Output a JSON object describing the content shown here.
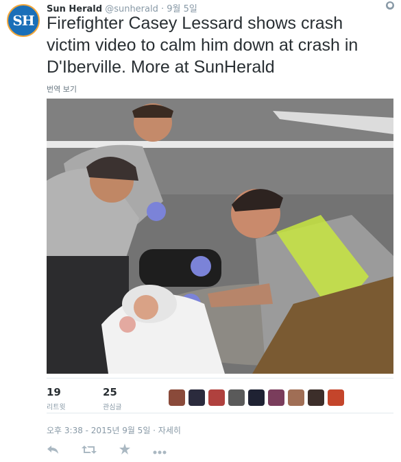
{
  "account": {
    "name": "Sun Herald",
    "handle": "@sunherald",
    "separator": "·",
    "date": "9월 5일",
    "avatar_text": "SH"
  },
  "tweet": {
    "text": "Firefighter Casey Lessard shows crash victim video to calm him down at crash in D'Iberville. More at SunHerald",
    "translate_label": "번역 보기"
  },
  "stats": {
    "retweets": {
      "count": "19",
      "label": "리트윗"
    },
    "likes": {
      "count": "25",
      "label": "관심글"
    }
  },
  "likers": [
    {
      "icon": "liker-avatar-1",
      "color": "#8a4a3a"
    },
    {
      "icon": "liker-avatar-2",
      "color": "#2b2b3d"
    },
    {
      "icon": "liker-avatar-3",
      "color": "#b0413e"
    },
    {
      "icon": "liker-avatar-4",
      "color": "#5a5a5a"
    },
    {
      "icon": "liker-avatar-5",
      "color": "#1f2233"
    },
    {
      "icon": "liker-avatar-6",
      "color": "#7a3d5c"
    },
    {
      "icon": "liker-avatar-7",
      "color": "#a06e55"
    },
    {
      "icon": "liker-avatar-8",
      "color": "#3c2e2a"
    },
    {
      "icon": "liker-avatar-9",
      "color": "#c4452b"
    }
  ],
  "timestamp": "오후 3:38 - 2015년 9월 5일 · 자세히",
  "actions": {
    "reply": "reply-icon",
    "retweet": "retweet-icon",
    "favorite": "star-icon",
    "more": "more-icon"
  },
  "colors": {
    "avatar_bg": "#1a6fb8",
    "avatar_ring": "#f2a73b",
    "muted": "#8899a6",
    "text": "#292f33"
  }
}
